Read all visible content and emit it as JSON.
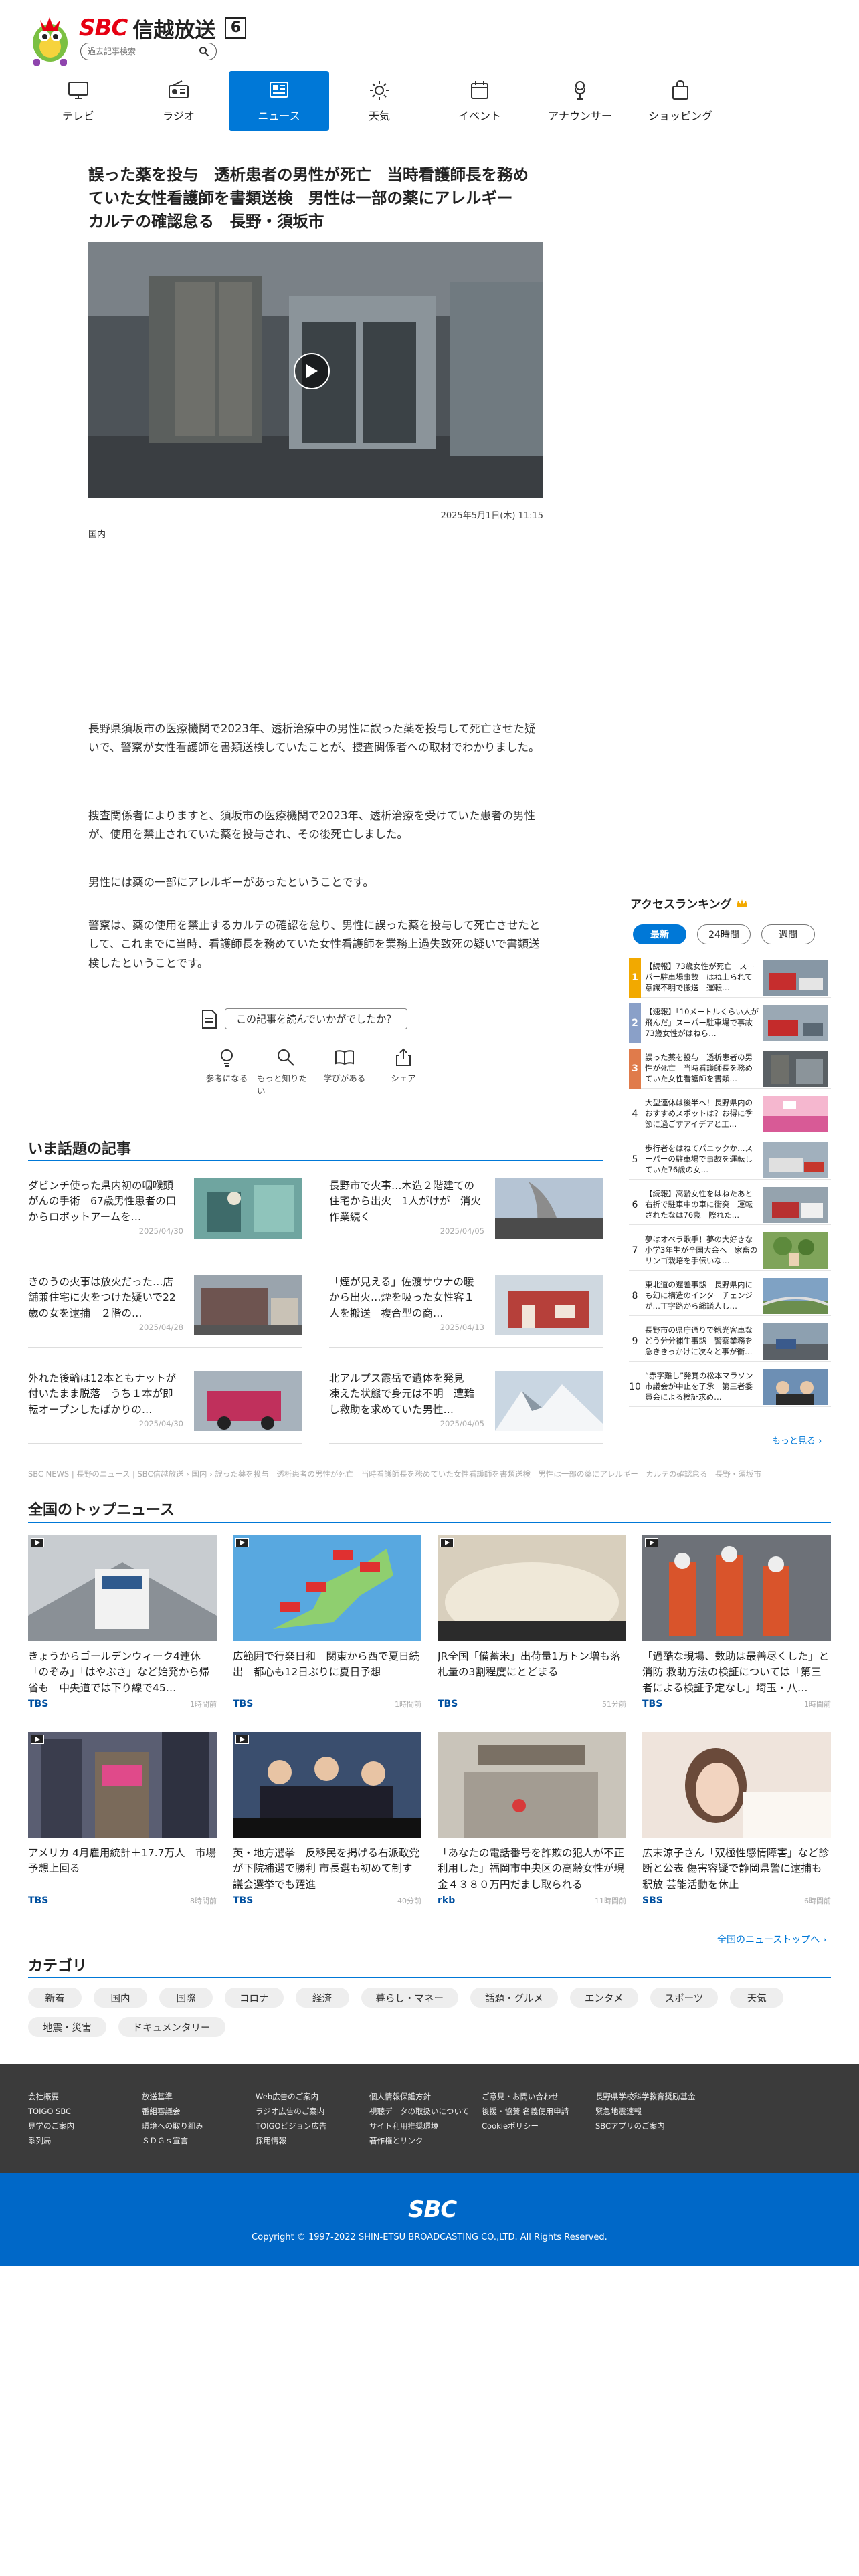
{
  "header": {
    "logo_sbc": "SBC",
    "logo_name": "信越放送",
    "channel": "6",
    "search_placeholder": "過去記事検索"
  },
  "nav": [
    {
      "label": "テレビ",
      "icon": "tv-icon"
    },
    {
      "label": "ラジオ",
      "icon": "radio-icon"
    },
    {
      "label": "ニュース",
      "icon": "news-icon",
      "active": true
    },
    {
      "label": "天気",
      "icon": "sun-icon"
    },
    {
      "label": "イベント",
      "icon": "calendar-icon"
    },
    {
      "label": "アナウンサー",
      "icon": "microphone-icon"
    },
    {
      "label": "ショッピング",
      "icon": "shopping-bag-icon"
    }
  ],
  "article": {
    "title": "誤った薬を投与　透析患者の男性が死亡　当時看護師長を務めていた女性看護師を書類送検　男性は一部の薬にアレルギー　カルテの確認怠る　長野・須坂市",
    "date": "2025年5月1日(木) 11:15",
    "category": "国内",
    "paragraphs": [
      "長野県須坂市の医療機関で2023年、透析治療中の男性に誤った薬を投与して死亡させた疑いで、警察が女性看護師を書類送検していたことが、捜査関係者への取材でわかりました。",
      "捜査関係者によりますと、須坂市の医療機関で2023年、透析治療を受けていた患者の男性が、使用を禁止されていた薬を投与され、その後死亡しました。",
      "男性には薬の一部にアレルギーがあったということです。",
      "警察は、薬の使用を禁止するカルテの確認を怠り、男性に誤った薬を投与して死亡させたとして、これまでに当時、看護師長を務めていた女性看護師を業務上過失致死の疑いで書類送検したということです。"
    ],
    "feedback_question": "この記事を読んでいかがでしたか？",
    "reactions": [
      "参考になる",
      "もっと知りたい",
      "学びがある",
      "シェア"
    ]
  },
  "hot": {
    "title": "いま話題の記事",
    "items": [
      {
        "title": "ダビンチ使った県内初の咽喉頭がんの手術　67歳男性患者の口からロボットアームを…",
        "date": "2025/04/30"
      },
      {
        "title": "長野市で火事…木造２階建ての住宅から出火　1人がけが　消火作業続く",
        "date": "2025/04/05"
      },
      {
        "title": "きのうの火事は放火だった…店舗兼住宅に火をつけた疑いで22歳の女を逮捕　２階の…",
        "date": "2025/04/28"
      },
      {
        "title": "「煙が見える」佐渡サウナの暖から出火…煙を吸った女性客１人を搬送　複合型の商…",
        "date": "2025/04/13"
      },
      {
        "title": "外れた後輪は12本ともナットが付いたまま脱落　うち１本が即転オープンしたばかりの…",
        "date": "2025/04/30"
      },
      {
        "title": "北アルプス霞岳で遺体を発見　凍えた状態で身元は不明　遭難し救助を求めていた男性…",
        "date": "2025/04/05"
      }
    ]
  },
  "ranking": {
    "title": "アクセスランキング",
    "tabs": [
      "最新",
      "24時間",
      "週間"
    ],
    "items": [
      {
        "num": "1",
        "title": "【続報】73歳女性が死亡　スーパー駐車場事故　はね上られて意識不明で搬送　運転…"
      },
      {
        "num": "2",
        "title": "【速報】「10メートルくらい人が飛んだ」スーパー駐車場で事故　73歳女性がはねら…"
      },
      {
        "num": "3",
        "title": "誤った薬を投与　透析患者の男性が死亡　当時看護師長を務めていた女性看護師を書類…"
      },
      {
        "num": "4",
        "title": "大型連休は後半へ！長野県内のおすすめスポットは？お得に季節に過ごすアイデアと工…"
      },
      {
        "num": "5",
        "title": "歩行者をはねてパニックか…スーパーの駐車場で事故を運転していた76歳の女…"
      },
      {
        "num": "6",
        "title": "【続報】高齢女性をはねたあと右折で駐車中の車に衝突　運転されたなは76歳　際れた…"
      },
      {
        "num": "7",
        "title": "夢はオベラ歌手！夢の大好きな小学3年生が全国大会へ　家畜のリンゴ栽培を手伝いな…"
      },
      {
        "num": "8",
        "title": "東北道の遅差事態　長野県内にも幻に構造のインターチェンジが…丁字路から総議人し…"
      },
      {
        "num": "9",
        "title": "長野市の県庁通りで観光客車などう分分補生事態　警察業務を急ききっかけに次々と事が衝…"
      },
      {
        "num": "10",
        "title": "“赤字難し”発覚の松本マラソン 市議会が中止を了承　第三者委員会による検証求め…"
      }
    ],
    "more": "もっと見る ›"
  },
  "breadcrumb": "SBC NEWS | 長野のニュース | SBC信越放送 › 国内 › 誤った薬を投与　透析患者の男性が死亡　当時看護師長を務めていた女性看護師を書類送検　男性は一部の薬にアレルギー　カルテの確認怠る　長野・須坂市",
  "topnews": {
    "title": "全国のトップニュース",
    "items": [
      {
        "title": "きょうからゴールデンウィーク4連休「のぞみ」「はやぶさ」など始発から帰省も　中央道では下り線で45…",
        "source": "TBS",
        "time": "1時間前"
      },
      {
        "title": "広範囲で行楽日和　関東から西で夏日続出　都心も12日ぶりに夏日予想",
        "source": "TBS",
        "time": "1時間前"
      },
      {
        "title": "JR全国「備蓄米」出荷量1万トン増も落札量の3割程度にとどまる",
        "source": "TBS",
        "time": "51分前"
      },
      {
        "title": "「過酷な現場、数助は最善尽くした」と消防 救助方法の検証については「第三者による検証予定なし」埼玉・八…",
        "source": "TBS",
        "time": "1時間前"
      },
      {
        "title": "アメリカ 4月雇用統計＋17.7万人　市場予想上回る",
        "source": "TBS",
        "time": "8時間前"
      },
      {
        "title": "英・地方選挙　反移民を掲げる右派政党が下院補選で勝利 市長選も初めて制す　議会選挙でも躍進",
        "source": "TBS",
        "time": "40分前"
      },
      {
        "title": "「あなたの電話番号を詐欺の犯人が不正利用した」福岡市中央区の高齢女性が現金４３８０万円だまし取られる",
        "source": "rkb",
        "time": "11時間前"
      },
      {
        "title": "広末涼子さん「双極性感情障害」など診断と公表 傷害容疑で静岡県警に逮捕も釈放 芸能活動を休止",
        "source": "SBS",
        "time": "6時間前"
      }
    ],
    "more": "全国のニューストップへ ›"
  },
  "categories": {
    "title": "カテゴリ",
    "items": [
      "新着",
      "国内",
      "国際",
      "コロナ",
      "経済",
      "暮らし・マネー",
      "話題・グルメ",
      "エンタメ",
      "スポーツ",
      "天気",
      "地震・災害",
      "ドキュメンタリー"
    ]
  },
  "footer": {
    "columns": [
      [
        "会社概要",
        "TOIGO SBC",
        "見学のご案内",
        "系列局"
      ],
      [
        "放送基準",
        "番組審議会",
        "環境への取り組み",
        "ＳＤＧｓ宣言"
      ],
      [
        "Web広告のご案内",
        "ラジオ広告のご案内",
        "TOIGOビジョン広告",
        "採用情報"
      ],
      [
        "個人情報保護方針",
        "視聴データの取扱いについて",
        "サイト利用推奨環境",
        "著作権とリンク"
      ],
      [
        "ご意見・お問い合わせ",
        "後援・協賛 名義使用申請",
        "Cookieポリシー"
      ],
      [
        "長野県学校科学教育奨励基金",
        "緊急地震速報",
        "SBCアプリのご案内"
      ]
    ],
    "logo": "SBC",
    "copyright": "Copyright © 1997-2022 SHIN-ETSU BROADCASTING CO.,LTD. All Rights Reserved."
  },
  "colors": {
    "accent": "#0078d7",
    "brand_red": "#e60012",
    "footer_dark": "#3b3b3b",
    "footer_blue": "#0068c8"
  }
}
